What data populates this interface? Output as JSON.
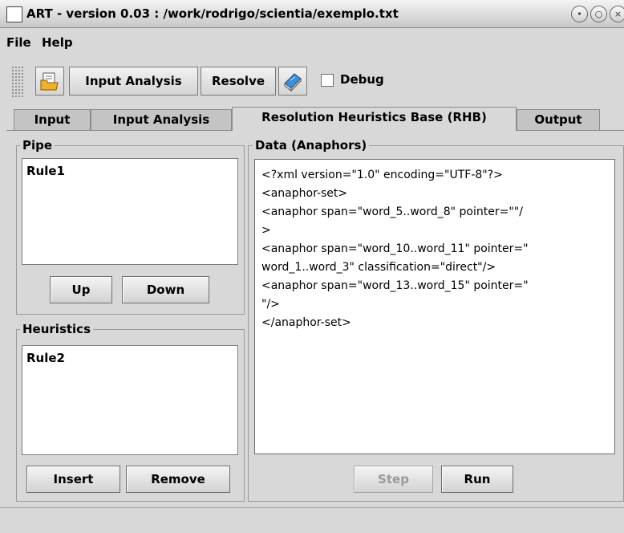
{
  "window": {
    "title": "ART - version 0.03 : /work/rodrigo/scientia/exemplo.txt"
  },
  "menu": {
    "items": [
      "File",
      "Help"
    ]
  },
  "toolbar": {
    "input_analysis_label": "Input Analysis",
    "resolve_label": "Resolve",
    "debug_label": "Debug",
    "debug_checked": false
  },
  "tabs": [
    {
      "label": "Input"
    },
    {
      "label": "Input Analysis"
    },
    {
      "label": "Resolution Heuristics Base (RHB)",
      "active": true
    },
    {
      "label": "Output"
    }
  ],
  "pipe": {
    "title": "Pipe",
    "items": [
      "Rule1"
    ],
    "up_label": "Up",
    "down_label": "Down"
  },
  "heuristics": {
    "title": "Heuristics",
    "items": [
      "Rule2"
    ],
    "insert_label": "Insert",
    "remove_label": "Remove"
  },
  "data": {
    "title": "Data (Anaphors)",
    "lines": [
      "<?xml version=\"1.0\" encoding=\"UTF-8\"?>",
      "<anaphor-set>",
      "<anaphor span=\"word_5..word_8\" pointer=\"\"/",
      ">",
      "<anaphor span=\"word_10..word_11\" pointer=\"",
      "word_1..word_3\" classification=\"direct\"/>",
      "<anaphor span=\"word_13..word_15\" pointer=\"",
      "\"/>",
      "</anaphor-set>"
    ],
    "step_label": "Step",
    "run_label": "Run"
  },
  "colors": {
    "accent": "#f0a030",
    "background": "#d8d8d8"
  }
}
